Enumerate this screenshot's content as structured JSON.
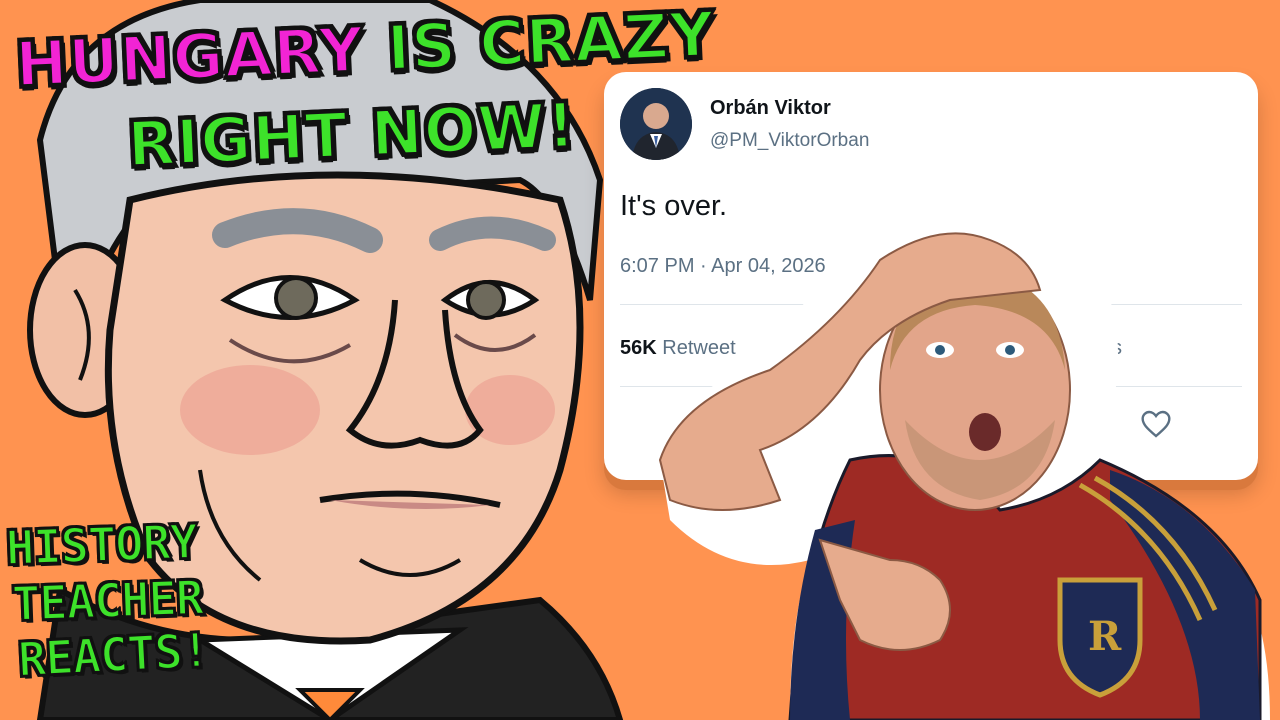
{
  "headline": {
    "word1": "HUNGARY",
    "word2": "IS CRAZY",
    "line2": "RIGHT NOW!"
  },
  "side_caption": {
    "line1": "HISTORY",
    "line2": "TEACHER",
    "line3": "REACTS!"
  },
  "tweet": {
    "author_name": "Orbán Viktor",
    "author_handle": "@PM_ViktorOrban",
    "text": "It's over.",
    "timestamp": "6:07 PM · Apr 04, 2026",
    "retweet_count": "56K",
    "retweet_label_partial": "Retweet",
    "stats_tail_partial": "s",
    "like_icon": "heart-icon"
  },
  "colors": {
    "background": "#ff9350",
    "headline_pink": "#f224d4",
    "headline_green": "#3de22a",
    "card": "#ffffff",
    "jersey": "#9e2a24"
  }
}
